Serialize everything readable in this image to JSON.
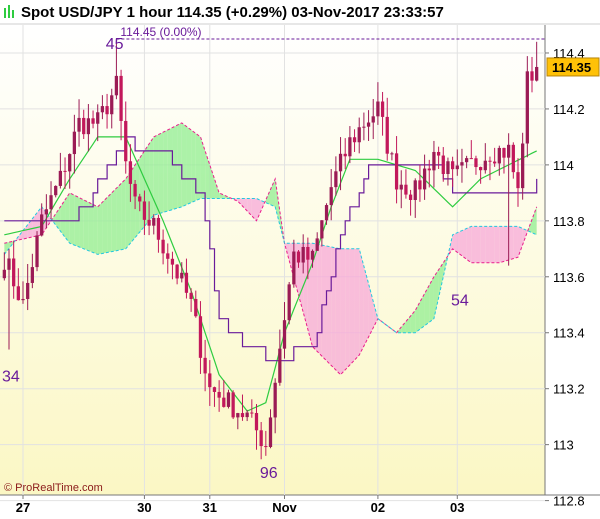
{
  "header": {
    "title": "Spot USD/JPY   1 hour   114.35 (+0.29%)   03-Nov-2017 23:33:57"
  },
  "colors": {
    "bull": "#9b1b55",
    "bear": "#c2185b",
    "tenkan": "#2ecc40",
    "kijun": "#6a1b9a",
    "cloud_bull": "#90ee90",
    "cloud_bear": "#f7a8d8",
    "price_box": "#ffc107"
  },
  "chart_data": {
    "type": "candlestick",
    "instrument": "Spot USD/JPY",
    "timeframe": "1 hour",
    "last_price": 114.35,
    "change_pct": "+0.29%",
    "timestamp": "03-Nov-2017 23:33:57",
    "ylim": [
      112.82,
      114.5
    ],
    "yticks": [
      112.8,
      113,
      113.2,
      113.4,
      113.6,
      113.8,
      114,
      114.2,
      114.4
    ],
    "ytick_labels": [
      "112.8",
      "113",
      "113.2",
      "113.4",
      "113.6",
      "113.8",
      "114",
      "114.2",
      "114.4"
    ],
    "xtick_labels": [
      "27",
      "30",
      "31",
      "Nov",
      "02",
      "03"
    ],
    "xtick_index": [
      4,
      30,
      44,
      60,
      80,
      97
    ],
    "n_bars": 115,
    "grid": true,
    "current_price_label": "114.35",
    "max_label": "114.45 (0.00%)",
    "max_value": 114.45,
    "max_index": 24,
    "annotations": [
      {
        "text": "34",
        "index": 1,
        "value": 113.34
      },
      {
        "text": "45",
        "index": 23,
        "value": 114.45
      },
      {
        "text": "96",
        "index": 56,
        "value": 112.96
      },
      {
        "text": "54",
        "index": 95,
        "value": 113.54
      }
    ],
    "close_anchors": [
      [
        0,
        113.67
      ],
      [
        4,
        113.5
      ],
      [
        8,
        113.8
      ],
      [
        12,
        113.95
      ],
      [
        16,
        114.15
      ],
      [
        20,
        114.15
      ],
      [
        24,
        114.28
      ],
      [
        26,
        114.0
      ],
      [
        28,
        113.85
      ],
      [
        32,
        113.78
      ],
      [
        36,
        113.65
      ],
      [
        40,
        113.5
      ],
      [
        44,
        113.2
      ],
      [
        48,
        113.15
      ],
      [
        52,
        113.1
      ],
      [
        56,
        113.0
      ],
      [
        59,
        113.35
      ],
      [
        62,
        113.68
      ],
      [
        66,
        113.66
      ],
      [
        70,
        113.92
      ],
      [
        74,
        114.08
      ],
      [
        77,
        114.15
      ],
      [
        80,
        114.2
      ],
      [
        84,
        113.95
      ],
      [
        88,
        113.9
      ],
      [
        92,
        114.05
      ],
      [
        96,
        113.95
      ],
      [
        100,
        114.0
      ],
      [
        104,
        114.05
      ],
      [
        108,
        114.05
      ],
      [
        110,
        113.9
      ],
      [
        112,
        114.3
      ],
      [
        114,
        114.35
      ]
    ],
    "tenkan_anchors": [
      [
        0,
        113.75
      ],
      [
        8,
        113.78
      ],
      [
        14,
        113.95
      ],
      [
        20,
        114.1
      ],
      [
        26,
        114.1
      ],
      [
        30,
        113.95
      ],
      [
        34,
        113.8
      ],
      [
        40,
        113.55
      ],
      [
        46,
        113.25
      ],
      [
        52,
        113.12
      ],
      [
        56,
        113.15
      ],
      [
        60,
        113.4
      ],
      [
        66,
        113.65
      ],
      [
        70,
        113.85
      ],
      [
        74,
        114.02
      ],
      [
        80,
        114.02
      ],
      [
        88,
        113.98
      ],
      [
        96,
        113.85
      ],
      [
        102,
        113.95
      ],
      [
        108,
        114.0
      ],
      [
        114,
        114.05
      ]
    ],
    "kijun_anchors": [
      [
        0,
        113.8
      ],
      [
        12,
        113.78
      ],
      [
        18,
        113.85
      ],
      [
        22,
        114.0
      ],
      [
        26,
        114.08
      ],
      [
        34,
        114.05
      ],
      [
        38,
        113.95
      ],
      [
        42,
        113.9
      ],
      [
        46,
        113.45
      ],
      [
        52,
        113.35
      ],
      [
        58,
        113.3
      ],
      [
        66,
        113.35
      ],
      [
        72,
        113.75
      ],
      [
        78,
        113.98
      ],
      [
        84,
        114.0
      ],
      [
        92,
        114.0
      ],
      [
        96,
        113.9
      ],
      [
        104,
        113.88
      ],
      [
        112,
        113.88
      ],
      [
        114,
        113.95
      ]
    ],
    "span_a_anchors": [
      [
        0,
        113.72
      ],
      [
        8,
        113.75
      ],
      [
        14,
        113.9
      ],
      [
        20,
        113.85
      ],
      [
        26,
        113.95
      ],
      [
        32,
        114.1
      ],
      [
        38,
        114.15
      ],
      [
        42,
        114.1
      ],
      [
        46,
        113.9
      ],
      [
        50,
        113.87
      ],
      [
        54,
        113.8
      ],
      [
        58,
        113.95
      ],
      [
        60,
        113.72
      ],
      [
        66,
        113.35
      ],
      [
        72,
        113.25
      ],
      [
        76,
        113.32
      ],
      [
        80,
        113.45
      ],
      [
        84,
        113.4
      ],
      [
        88,
        113.48
      ],
      [
        92,
        113.6
      ],
      [
        96,
        113.7
      ],
      [
        100,
        113.65
      ],
      [
        106,
        113.65
      ],
      [
        110,
        113.67
      ],
      [
        114,
        113.85
      ]
    ],
    "span_b_anchors": [
      [
        0,
        113.68
      ],
      [
        8,
        113.85
      ],
      [
        14,
        113.72
      ],
      [
        20,
        113.68
      ],
      [
        26,
        113.7
      ],
      [
        32,
        113.82
      ],
      [
        38,
        113.85
      ],
      [
        42,
        113.88
      ],
      [
        46,
        113.88
      ],
      [
        50,
        113.88
      ],
      [
        54,
        113.88
      ],
      [
        58,
        113.85
      ],
      [
        60,
        113.72
      ],
      [
        66,
        113.72
      ],
      [
        72,
        113.7
      ],
      [
        76,
        113.7
      ],
      [
        80,
        113.45
      ],
      [
        84,
        113.4
      ],
      [
        88,
        113.4
      ],
      [
        92,
        113.45
      ],
      [
        96,
        113.75
      ],
      [
        100,
        113.78
      ],
      [
        106,
        113.78
      ],
      [
        110,
        113.78
      ],
      [
        114,
        113.75
      ]
    ]
  },
  "footer": {
    "copyright": "© ProRealTime.com"
  }
}
